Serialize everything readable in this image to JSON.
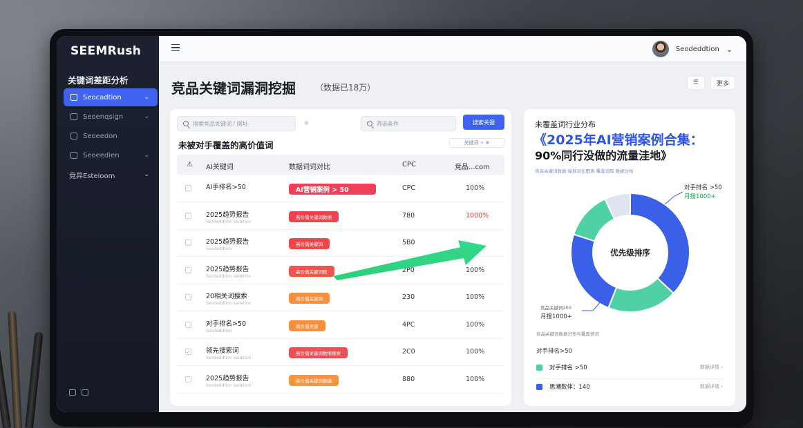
{
  "sidebar": {
    "logo": "SEEMRush",
    "section_title": "关键词差距分析",
    "items": [
      {
        "label": "Seocadtion"
      },
      {
        "label": "Seoenqsign"
      },
      {
        "label": "Seoeedon"
      },
      {
        "label": "Seoeedien"
      },
      {
        "label": "竞异Esteioom"
      }
    ]
  },
  "topbar": {
    "username": "Seodeddtion"
  },
  "page": {
    "title": "竞品关键词漏洞挖掘",
    "subtitle": "（数据已18万）",
    "btn_list": "☰",
    "btn_more": "更多"
  },
  "search": {
    "placeholder_1": "搜索竞品关键词 / 网址",
    "mini_mark": "※",
    "placeholder_2": "筛选条件",
    "button": "搜索关键"
  },
  "table": {
    "title": "未被对手覆盖的高价值词",
    "control": "关键词 ÷  ⊕",
    "headers": [
      "AI关键词",
      "数据词词对比",
      "CPC",
      "竞品...com"
    ],
    "rows": [
      {
        "kw": "AI手排名>50",
        "sub": "",
        "pill": "AI营销案例  > 50",
        "pill_color": "#ef4057",
        "big": true,
        "cpc": "CPC",
        "pct": "100%",
        "red": false
      },
      {
        "kw": "2025趋势报告",
        "sub": "Seodeddtion sedetion",
        "pill": "高价值关键词数据",
        "pill_color": "#f0424e",
        "big": false,
        "cpc": "780",
        "pct": "1000%",
        "red": true
      },
      {
        "kw": "2025趋势报告",
        "sub": "Seodeddtion",
        "pill": "高价值关键词",
        "pill_color": "#f0474d",
        "big": false,
        "cpc": "5B0",
        "pct": "",
        "red": false
      },
      {
        "kw": "2025趋势报告",
        "sub": "Seodeddtion sedetion",
        "pill": "高价值关键词数",
        "pill_color": "#f1544c",
        "big": false,
        "cpc": "2P0",
        "pct": "100%",
        "red": false
      },
      {
        "kw": "20相关词搜索",
        "sub": "Seodeddtion sedetion",
        "pill": "高价值关键词",
        "pill_color": "#f6903f",
        "big": false,
        "cpc": "230",
        "pct": "100%",
        "red": false
      },
      {
        "kw": "对手排名>50",
        "sub": "Seodeddtion",
        "pill": "高价值关键",
        "pill_color": "#f6903f",
        "big": false,
        "cpc": "4PC",
        "pct": "100%",
        "red": false
      },
      {
        "kw": "领先搜索词",
        "sub": "Seodeddtion sedetion",
        "pill": "高价值关键词数据搜索",
        "pill_color": "#f04e55",
        "big": false,
        "cpc": "2C0",
        "pct": "100%",
        "red": false
      },
      {
        "kw": "2025趋势报告",
        "sub": "Seodeddtion sedetion",
        "pill": "高价值关键词数据",
        "pill_color": "#f6953f",
        "big": false,
        "cpc": "880",
        "pct": "100%",
        "red": false
      }
    ]
  },
  "right": {
    "label": "未覆盖词行业分布",
    "headline_1": "《2025年AI营销案例合集：",
    "headline_2": "90%同行没做的流量洼地》",
    "legend_line": "竞品关键词数据 指标对比图表    覆盖词库 数据分析",
    "center": "优先级排序",
    "callout1_line1": "对手排名 >50",
    "callout1_line2": "月搜1000+",
    "callout2_line1": "竞品关键词200",
    "callout2_line2": "月搜1000+",
    "small_text": "竞品关键词数据分布与覆盖情况",
    "stat": "对手排名>50",
    "legend": [
      {
        "label": "对手排名 >50",
        "right": "数据详情 ›",
        "color": "#4fd1a5"
      },
      {
        "label": "思潮数体：140",
        "right": "数据详情 ›",
        "color": "#3a5fe8"
      }
    ]
  },
  "chart_data": {
    "type": "pie",
    "segments": [
      {
        "value": 37,
        "color": "#3a5fe8"
      },
      {
        "value": 19,
        "color": "#4fd1a5"
      },
      {
        "value": 24,
        "color": "#3a5fe8"
      },
      {
        "value": 13,
        "color": "#4fd1a5"
      },
      {
        "value": 7,
        "color": "#dfe5f0"
      }
    ]
  }
}
